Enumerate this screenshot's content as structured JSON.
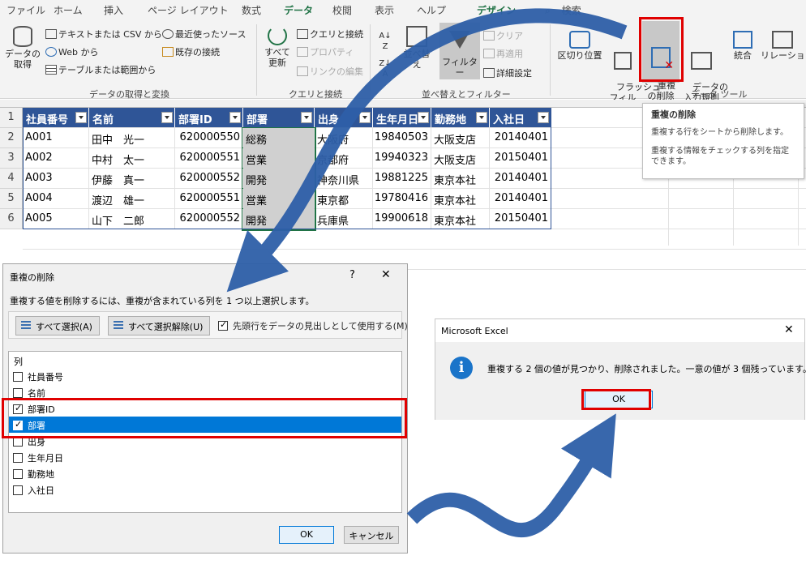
{
  "ribbon": {
    "tabs": [
      "ファイル",
      "ホーム",
      "挿入",
      "ページ レイアウト",
      "数式",
      "データ",
      "校閲",
      "表示",
      "ヘルプ",
      "デザイン"
    ],
    "active_tab": "データ",
    "search_label": "検索",
    "get_data": {
      "big_button": "データの\n取得",
      "items": [
        "テキストまたは CSV から",
        "Web から",
        "テーブルまたは範囲から",
        "最近使ったソース",
        "既存の接続"
      ],
      "group_label": "データの取得と変換"
    },
    "queries": {
      "big_button": "すべて\n更新",
      "items": [
        "クエリと接続",
        "プロパティ",
        "リンクの編集"
      ],
      "group_label": "クエリと接続"
    },
    "sort_filter": {
      "sort_label": "並べ替え",
      "filter_label": "フィルター",
      "items": [
        "クリア",
        "再適用",
        "詳細設定"
      ],
      "group_label": "並べ替えとフィルター"
    },
    "data_tools": {
      "buttons": [
        "区切り位置",
        "フラッシュ\nフィル",
        "重複\nの削除",
        "データの\n入力規則",
        "統合",
        "リレーションシップ"
      ],
      "group_label": "データ ツール"
    }
  },
  "tooltip": {
    "title": "重複の削除",
    "line1": "重複する行をシートから削除します。",
    "line2": "重複する情報をチェックする列を指定できます。"
  },
  "sheet": {
    "row_numbers": [
      "1",
      "2",
      "3",
      "4",
      "5",
      "6"
    ],
    "headers": [
      "社員番号",
      "名前",
      "部署ID",
      "部署",
      "出身",
      "生年月日",
      "勤務地",
      "入社日"
    ],
    "rows": [
      [
        "A001",
        "田中　光一",
        "620000550",
        "総務",
        "大阪府",
        "19840503",
        "大阪支店",
        "20140401"
      ],
      [
        "A002",
        "中村　太一",
        "620000551",
        "営業",
        "京都府",
        "19940323",
        "大阪支店",
        "20150401"
      ],
      [
        "A003",
        "伊藤　真一",
        "620000552",
        "開発",
        "神奈川県",
        "19881225",
        "東京本社",
        "20140401"
      ],
      [
        "A004",
        "渡辺　雄一",
        "620000551",
        "営業",
        "東京都",
        "19780416",
        "東京本社",
        "20140401"
      ],
      [
        "A005",
        "山下　二郎",
        "620000552",
        "開発",
        "兵庫県",
        "19900618",
        "東京本社",
        "20150401"
      ]
    ]
  },
  "dialog": {
    "title": "重複の削除",
    "help": "?",
    "instruction": "重複する値を削除するには、重複が含まれている列を 1 つ以上選択します。",
    "select_all": "すべて選択(A)",
    "unselect_all": "すべて選択解除(U)",
    "header_option": "先頭行をデータの見出しとして使用する(M)",
    "list_header": "列",
    "columns": [
      {
        "label": "社員番号",
        "checked": false
      },
      {
        "label": "名前",
        "checked": false
      },
      {
        "label": "部署ID",
        "checked": true
      },
      {
        "label": "部署",
        "checked": true
      },
      {
        "label": "出身",
        "checked": false
      },
      {
        "label": "生年月日",
        "checked": false
      },
      {
        "label": "勤務地",
        "checked": false
      },
      {
        "label": "入社日",
        "checked": false
      }
    ],
    "ok": "OK",
    "cancel": "キャンセル"
  },
  "message": {
    "title": "Microsoft Excel",
    "text": "重複する 2 個の値が見つかり、削除されました。一意の値が 3 個残っています。",
    "ok": "OK"
  },
  "colors": {
    "accent": "#217346",
    "table_header": "#2f5597",
    "highlight": "#e00000",
    "arrow": "#2e5fa8",
    "selection": "#0078d7"
  }
}
